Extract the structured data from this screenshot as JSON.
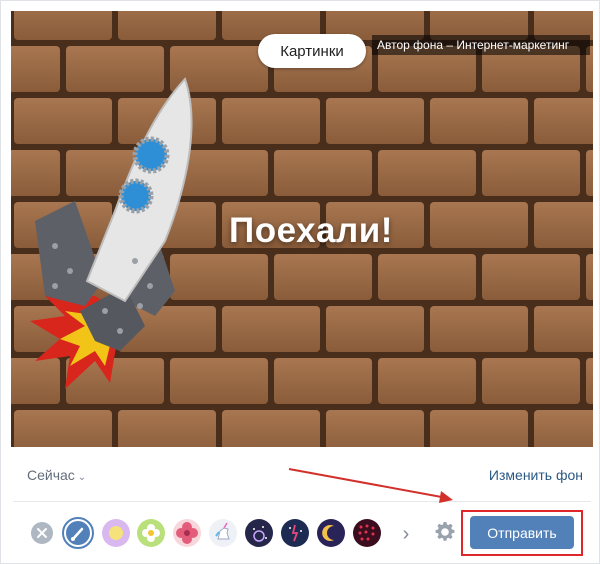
{
  "canvas": {
    "pictures_button": "Картинки",
    "author_label": "Автор фона – Интернет-маркетинг",
    "caption": "Поехали!"
  },
  "meta": {
    "time_label": "Сейчас",
    "change_background": "Изменить фон"
  },
  "toolbar": {
    "send_label": "Отправить",
    "icons": [
      "close-icon",
      "brush-icon",
      "yellow-circle-icon",
      "green-flower-icon",
      "pink-flower-icon",
      "unicorn-icon",
      "night-sky-icon",
      "star-figure-icon",
      "moon-icon",
      "red-dots-icon",
      "chevron-right-icon",
      "gear-icon"
    ]
  },
  "colors": {
    "brick": "#7a4f2f",
    "link": "#2a5885",
    "send_button": "#5181b8",
    "highlight": "#e0262b"
  }
}
